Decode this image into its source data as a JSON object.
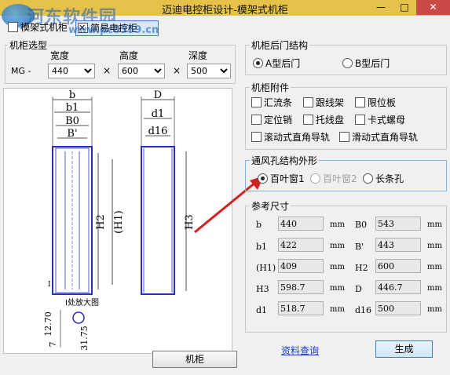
{
  "window": {
    "title": "迈迪电控柜设计-模架式机柜",
    "min_glyph": "—",
    "max_glyph": "□",
    "close_glyph": "✕"
  },
  "watermark": {
    "site_name": "河东软件园",
    "url": "www.pc0359.cn"
  },
  "tabs": [
    {
      "label": "模架式机柜"
    },
    {
      "label": "简易电控柜"
    }
  ],
  "cabinet_model": {
    "group_label": "机柜选型",
    "prefix": "MG -",
    "width_label": "宽度",
    "height_label": "高度",
    "depth_label": "深度",
    "width_value": "440",
    "height_value": "600",
    "depth_value": "500",
    "times_glyph": "×"
  },
  "rear_door": {
    "group_label": "机柜后门结构",
    "options": [
      {
        "label": "A型后门",
        "selected": true
      },
      {
        "label": "B型后门",
        "selected": false
      }
    ]
  },
  "accessories": {
    "group_label": "机柜附件",
    "items": [
      {
        "label": "汇流条"
      },
      {
        "label": "跟线架"
      },
      {
        "label": "限位板"
      },
      {
        "label": "定位销"
      },
      {
        "label": "托线盘"
      },
      {
        "label": "卡式螺母"
      },
      {
        "label": "滚动式直角导轨"
      },
      {
        "label": "滑动式直角导轨"
      }
    ]
  },
  "vent": {
    "group_label": "通风孔结构外形",
    "options": [
      {
        "label": "百叶窗1",
        "selected": true,
        "disabled": false
      },
      {
        "label": "百叶窗2",
        "selected": false,
        "disabled": true
      },
      {
        "label": "长条孔",
        "selected": false,
        "disabled": false
      }
    ]
  },
  "params": {
    "group_label": "参考尺寸",
    "unit": "mm",
    "rows": [
      {
        "l_name": "b",
        "l_value": "440",
        "r_name": "B0",
        "r_value": "543"
      },
      {
        "l_name": "b1",
        "l_value": "422",
        "r_name": "B'",
        "r_value": "443"
      },
      {
        "l_name": "(H1)",
        "l_value": "409",
        "r_name": "H2",
        "r_value": "600"
      },
      {
        "l_name": "H3",
        "l_value": "598.7",
        "r_name": "D",
        "r_value": "446.7"
      },
      {
        "l_name": "d1",
        "l_value": "518.7",
        "r_name": "d16",
        "r_value": "500"
      }
    ]
  },
  "drawing": {
    "dim_labels": {
      "b": "b",
      "b1": "b1",
      "b0": "B0",
      "bp": "B'",
      "h2": "H2",
      "h1": "(H1)",
      "h3": "H3",
      "d": "D",
      "d1": "d1",
      "d16": "d16",
      "detail": "I处放大图",
      "i_mark": "I",
      "dim_1270": "12.70",
      "dim_7": "7",
      "dim_3175": "31.75"
    },
    "stroke_color": "#1a1a1a",
    "frame_color": "#2a2fc8",
    "arrow_color": "#d42020"
  },
  "buttons": {
    "cabinet": "机柜",
    "query": "资料查询",
    "generate": "生成"
  }
}
